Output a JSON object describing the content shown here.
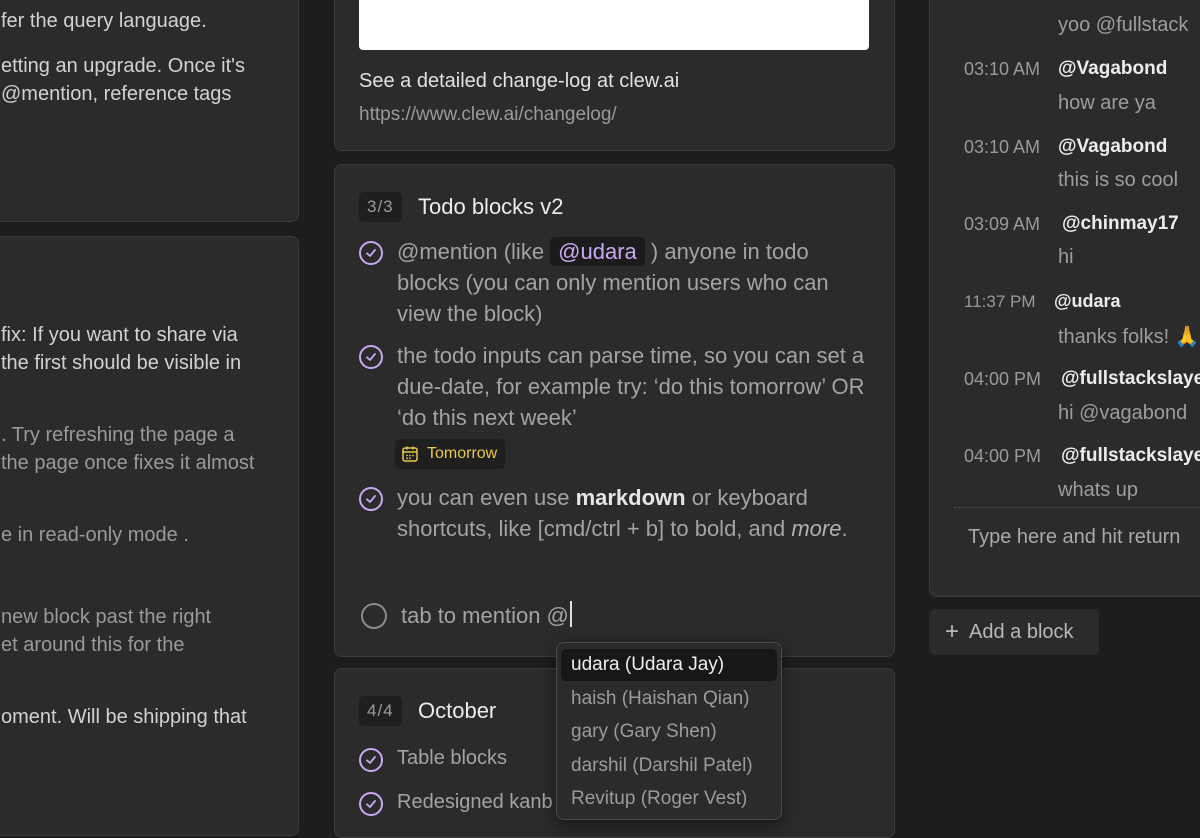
{
  "left_column": {
    "card1_lines": [
      "fer the query language.",
      "etting an upgrade. Once it's",
      "@mention, reference tags"
    ],
    "card2_lines": [
      "fix: If you want to share via",
      "the first should be visible in",
      ". Try refreshing the page a",
      "the page once fixes it almost",
      "e in read-only mode .",
      "new block past the right",
      "et around this for the",
      "oment. Will be shipping that"
    ]
  },
  "changelog_card": {
    "text": "See a detailed change-log at clew.ai",
    "link": "https://www.clew.ai/changelog/"
  },
  "todo_block": {
    "counter": "3/3",
    "title": "Todo blocks v2",
    "item1": {
      "before": "@mention (like ",
      "mention": "@udara",
      "after": " ) anyone in todo blocks (you can only mention users who can view the block)"
    },
    "item2": "the todo inputs can parse time, so you can set a due-date, for example try: ‘do this tomorrow’ OR ‘do this next week’",
    "date_chip": "Tomorrow",
    "item3": {
      "before": "you can even use ",
      "bold": "markdown",
      "middle": " or keyboard shortcuts, like [cmd/ctrl + b] to bold, and ",
      "italic": "more",
      "after": "."
    },
    "input_value": "tab to mention @"
  },
  "october_block": {
    "counter": "4/4",
    "title": "October",
    "items": [
      "Table blocks",
      "Redesigned kanb"
    ]
  },
  "mention_dropdown": {
    "options": [
      "udara (Udara Jay)",
      "haish (Haishan Qian)",
      "gary (Gary Shen)",
      "darshil (Darshil Patel)",
      "Revitup (Roger Vest)"
    ],
    "selected_index": 0
  },
  "chat": {
    "top_fragment": "yoo @fullstack",
    "messages": [
      {
        "time": "03:10 AM",
        "user": "@Vagabond",
        "text": "how are ya"
      },
      {
        "time": "03:10 AM",
        "user": "@Vagabond",
        "text": "this is so cool"
      },
      {
        "time": "03:09 AM",
        "user": "@chinmay17",
        "text": "hi"
      },
      {
        "time": "11:37 PM",
        "user": "@udara",
        "text": "thanks folks! 🙏"
      },
      {
        "time": "04:00 PM",
        "user": "@fullstackslaye",
        "text": "hi @vagabond"
      },
      {
        "time": "04:00 PM",
        "user": "@fullstackslaye",
        "text": "whats up"
      }
    ],
    "input_placeholder": "Type here and hit return"
  },
  "add_block_label": "Add a block",
  "icons": {
    "check": "checkmark-icon",
    "calendar": "calendar-icon",
    "plus": "plus-icon"
  },
  "colors": {
    "accent_purple": "#c9a9f2",
    "date_yellow": "#e8c94a",
    "background": "#1d1d1d",
    "card": "#2b2b2b"
  }
}
